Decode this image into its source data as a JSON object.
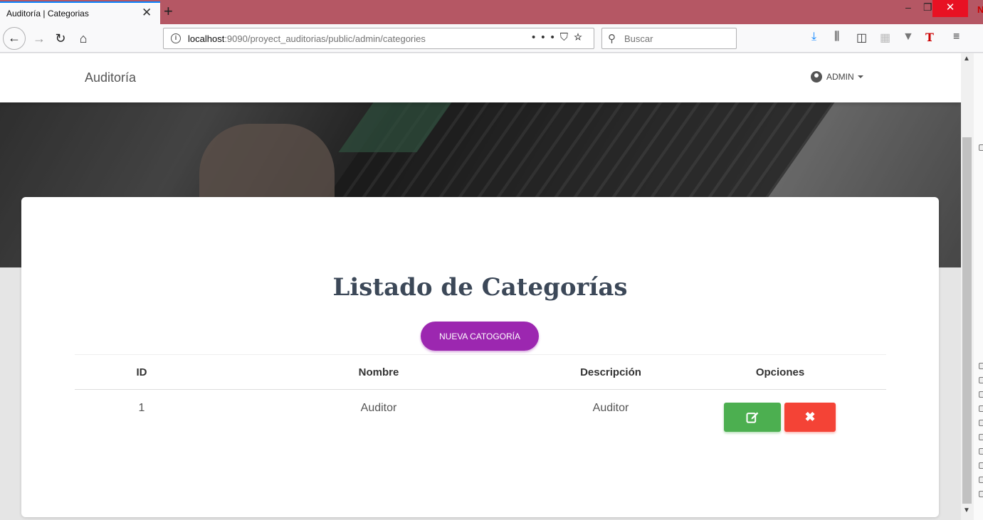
{
  "browser": {
    "tab_title": "Auditoría | Categorias",
    "url_host": "localhost",
    "url_rest": ":9090/proyect_auditorias/public/admin/categories",
    "search_placeholder": "Buscar",
    "icons": [
      "back-icon",
      "forward-icon",
      "reload-icon",
      "home-icon",
      "info-icon",
      "more-icon",
      "pocket-icon",
      "bookmark-star-icon",
      "search-icon",
      "download-icon",
      "library-icon",
      "sidebar-icon",
      "menu-icon"
    ]
  },
  "header": {
    "brand": "Auditoría",
    "user_label": "ADMIN"
  },
  "page": {
    "title": "Listado de Categorías",
    "new_button": "NUEVA CATOGORÍA"
  },
  "table": {
    "headers": [
      "ID",
      "Nombre",
      "Descripción",
      "Opciones"
    ],
    "rows": [
      {
        "id": "1",
        "nombre": "Auditor",
        "descripcion": "Auditor"
      }
    ]
  },
  "colors": {
    "primary_purple": "#9c27b0",
    "edit_green": "#4caf50",
    "delete_red": "#f44336",
    "titlebar": "#b55764"
  }
}
